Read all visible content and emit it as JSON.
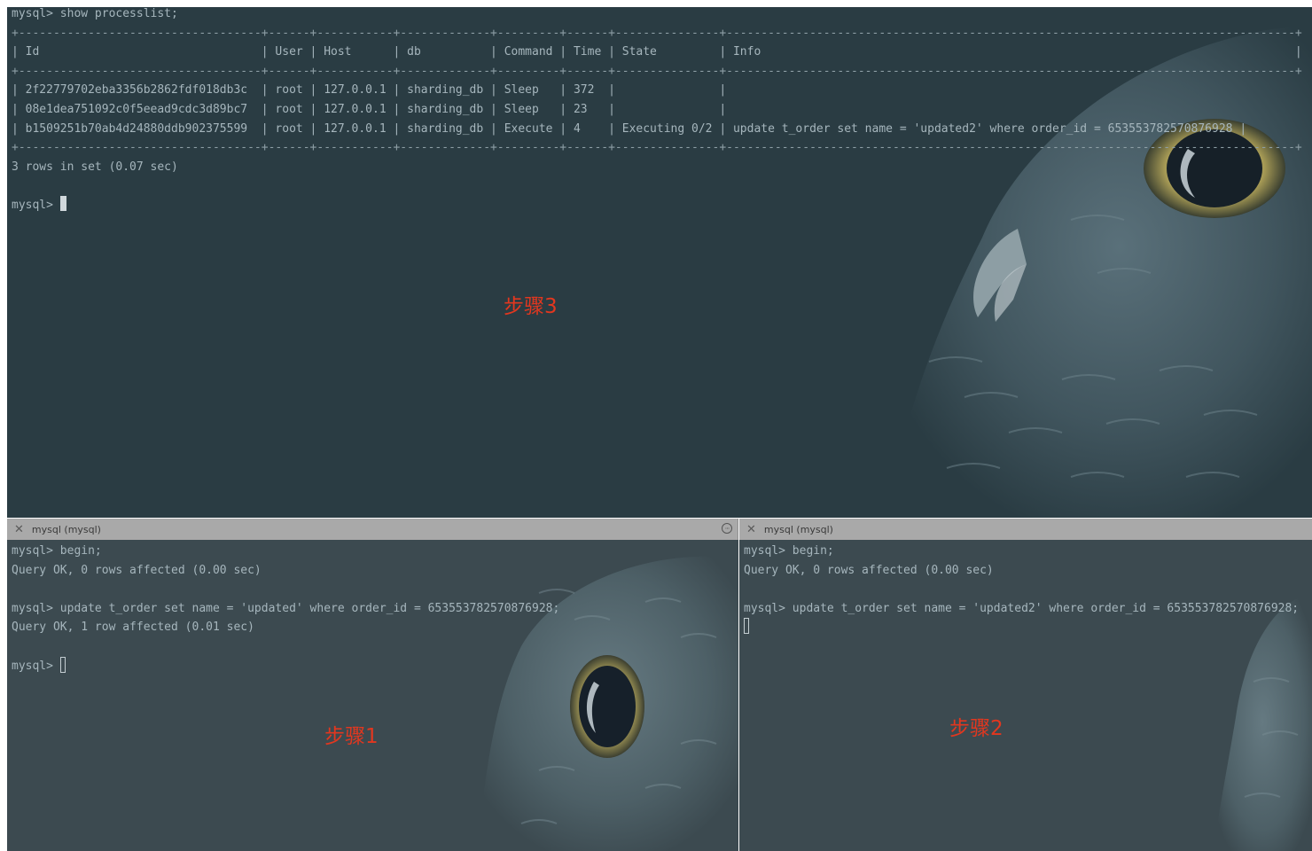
{
  "top_pane": {
    "command_line": "mysql> show processlist;",
    "separator": "+-----------------------------------+------+-----------+-------------+---------+------+---------------+----------------------------------------------------------------------------------+",
    "header_row": "| Id                                | User | Host      | db          | Command | Time | State         | Info                                                                             |",
    "rows": [
      "| 2f22779702eba3356b2862fdf018db3c  | root | 127.0.0.1 | sharding_db | Sleep   | 372  |               |                                                                                  ",
      "| 08e1dea751092c0f5eead9cdc3d89bc7  | root | 127.0.0.1 | sharding_db | Sleep   | 23   |               |                                                                                  ",
      "| b1509251b70ab4d24880ddb902375599  | root | 127.0.0.1 | sharding_db | Execute | 4    | Executing 0/2 | update t_order set name = 'updated2' where order_id = 653553782570876928 |"
    ],
    "summary": "3 rows in set (0.07 sec)",
    "prompt": "mysql> ",
    "step_label": "步骤3"
  },
  "left_pane": {
    "title": "mysql (mysql)",
    "lines": [
      "mysql> begin;",
      "Query OK, 0 rows affected (0.00 sec)",
      "",
      "mysql> update t_order set name = 'updated' where order_id = 653553782570876928;",
      "Query OK, 1 row affected (0.01 sec)",
      ""
    ],
    "prompt": "mysql> ",
    "step_label": "步骤1"
  },
  "right_pane": {
    "title": "mysql (mysql)",
    "lines": [
      "mysql> begin;",
      "Query OK, 0 rows affected (0.00 sec)",
      "",
      "mysql> update t_order set name = 'updated2' where order_id = 653553782570876928;"
    ],
    "step_label": "步骤2"
  },
  "icons": {
    "close": "close-icon",
    "menu": "more-options-icon",
    "background": "owl-wallpaper"
  },
  "colors": {
    "top_bg": "#2a3c43",
    "bottom_bg": "#3c4a50",
    "titlebar_bg": "#a9a9a9",
    "text": "#a6b6bd",
    "step_label": "#e2371f"
  }
}
